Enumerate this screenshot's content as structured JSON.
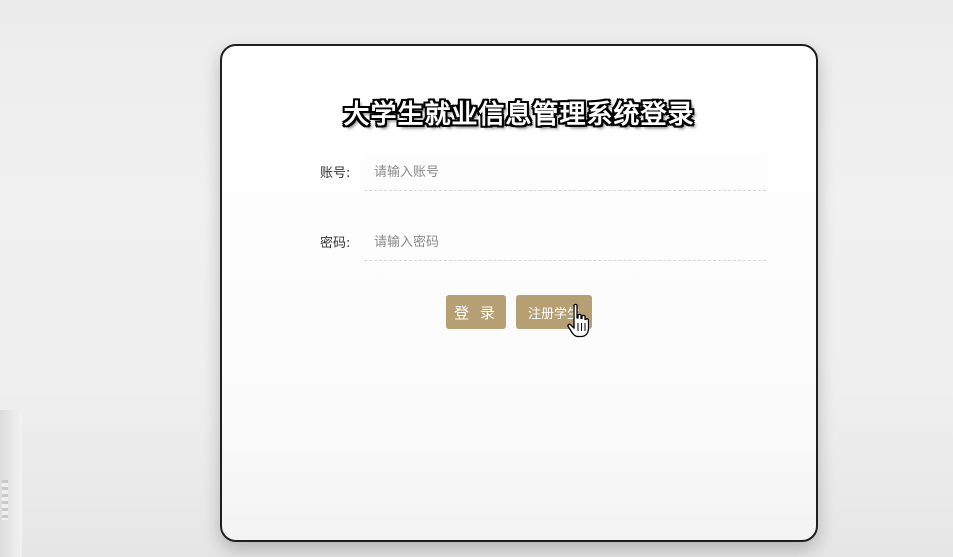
{
  "login": {
    "title": "大学生就业信息管理系统登录",
    "account": {
      "label": "账号:",
      "placeholder": "请输入账号",
      "value": ""
    },
    "password": {
      "label": "密码:",
      "placeholder": "请输入密码",
      "value": ""
    },
    "buttons": {
      "login_label": "登 录",
      "register_label": "注册学生"
    }
  },
  "colors": {
    "button_bg": "#b69f72",
    "button_text": "#ffffff",
    "card_border": "#1f1f1f"
  },
  "cursor": {
    "icon": "hand-pointer-icon"
  }
}
